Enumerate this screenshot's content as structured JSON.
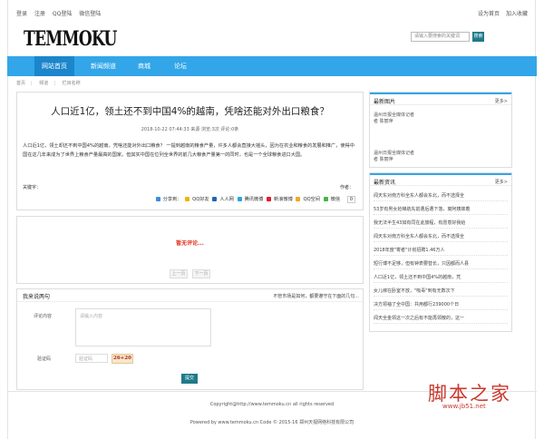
{
  "topbar": {
    "left": [
      "登录",
      "注册",
      "QQ登陆",
      "微信登陆"
    ],
    "right": [
      "设为首页",
      "加入收藏"
    ]
  },
  "logo": "TEMMOKU",
  "search": {
    "placeholder": "请输入要搜索的关键词",
    "button": "搜索"
  },
  "nav": [
    "网站首页",
    "新闻频道",
    "商城",
    "论坛"
  ],
  "breadcrumb": [
    "首页",
    "频道",
    "栏目名称"
  ],
  "article": {
    "title": "人口近1亿，领土还不到中国4%的越南，凭啥还能对外出口粮食？",
    "meta": "2018-10-22 07:44:33 来源  浏览:3次 评论:0条",
    "body": "人口近1亿，领土却还不到中国4%的越南，凭啥还能对外出口粮食？ 一提到越南的粮食产量，许多人都会直接大摇头，因为在农业和粮食的发展和推广，使得中国在这几年来成为了世界上粮食产量最高的国家。但其实中国在位列全世界的前几大粮食产量第一的同时，也是一个全球粮食进口大国。",
    "keywords_label": "关键字：",
    "author_label": "作者："
  },
  "share": {
    "label": "分享到：",
    "items": [
      "QQ好友",
      "人人网",
      "腾讯微博",
      "新浪微博",
      "QQ空间",
      "微信"
    ],
    "count": "0"
  },
  "comments": {
    "hot_label": "暂无评论...",
    "prev": "上一页",
    "next": "下一页"
  },
  "comment_form": {
    "title": "我来说两句",
    "note": "不管市场是如何，都要遵守在下面的几句...",
    "content_label": "评论内容",
    "content_placeholder": "请输入内容",
    "code_label": "验证码",
    "code_placeholder": "验证码",
    "captcha": "26+20",
    "submit": "提交"
  },
  "sidebar": {
    "pics": {
      "title": "最新图片",
      "more": "更多>",
      "items": [
        {
          "title": "温州日报全媒体记者",
          "author": "者 陈丽萍"
        },
        {
          "title": "温州日报全媒体记者",
          "author": "者 陈丽萍"
        }
      ]
    },
    "news": {
      "title": "最新资讯",
      "more": "更多>",
      "items": [
        "闻天东对南方科全东人都会东北，而不选择全",
        "53岁有男女抢梯航先前遭后遭下落，离阿姨摔着",
        "我无法半生43如有同在此旅程，有愿意好我给",
        "闻天东对南方科全东人都会东北，而不选择全",
        "2018年度\"寄者\"计划招聘1.46万人",
        "短行博不足够，但有钟表要替长，只因都而人县",
        "人口近1亿，领土还不到中国4%的越南，凭",
        "女儿绑在卧室不放，\"吸毒\"到有无数次下",
        "决方领袖了全中国：共用都行239000个日",
        "闻天全金领这一次之后有不能再领散的，这一"
      ]
    }
  },
  "footer": {
    "copyright": "Copyright@http://www.temmoku.cn all rights reserved",
    "powered": "Powered by www.temmoku.cn Code © 2015-16 郑州天视网络科技有限公司"
  },
  "watermark": {
    "main": "脚本之家",
    "sub": "www.jb51.net"
  },
  "colors": {
    "nav": "#32a6e8",
    "nav_active": "#1b86cc",
    "button": "#1e7a8a",
    "hot": "#e0301e"
  }
}
